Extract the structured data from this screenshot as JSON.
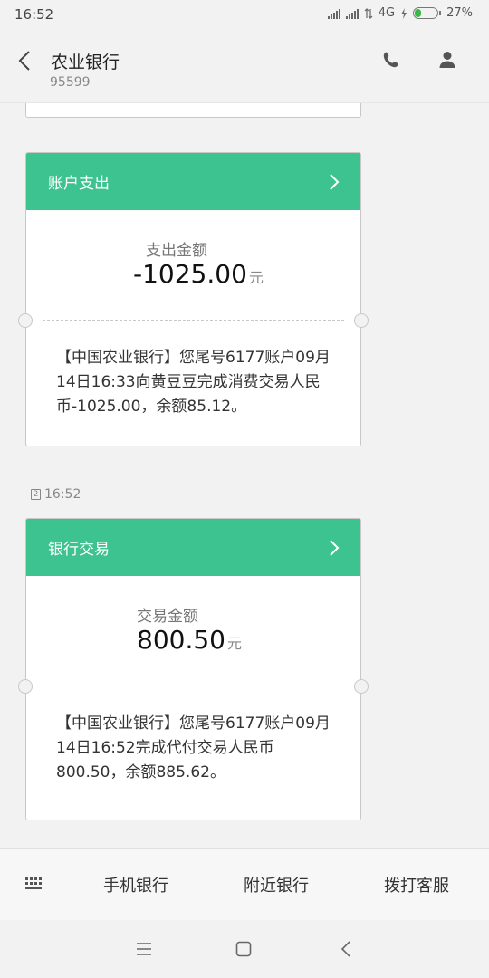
{
  "status_bar": {
    "time": "16:52",
    "network": "4G",
    "battery": "27%",
    "battery_level": 0.27
  },
  "header": {
    "title": "农业银行",
    "number": "95599"
  },
  "messages": [
    {
      "card_title": "账户支出",
      "amount_label": "支出金额",
      "amount": "-1025.00",
      "unit": "元",
      "text": "【中国农业银行】您尾号6177账户09月14日16:33向黄豆豆完成消费交易人民币-1025.00，余额85.12。"
    },
    {
      "timestamp": "16:52",
      "sim_slot": "2",
      "card_title": "银行交易",
      "amount_label": "交易金额",
      "amount": "800.50",
      "unit": "元",
      "text": "【中国农业银行】您尾号6177账户09月14日16:52完成代付交易人民币800.50，余额885.62。"
    }
  ],
  "bottom_menu": {
    "items": [
      "手机银行",
      "附近银行",
      "拨打客服"
    ]
  },
  "colors": {
    "card_header": "#3dc38f",
    "background": "#f2f2f2"
  }
}
